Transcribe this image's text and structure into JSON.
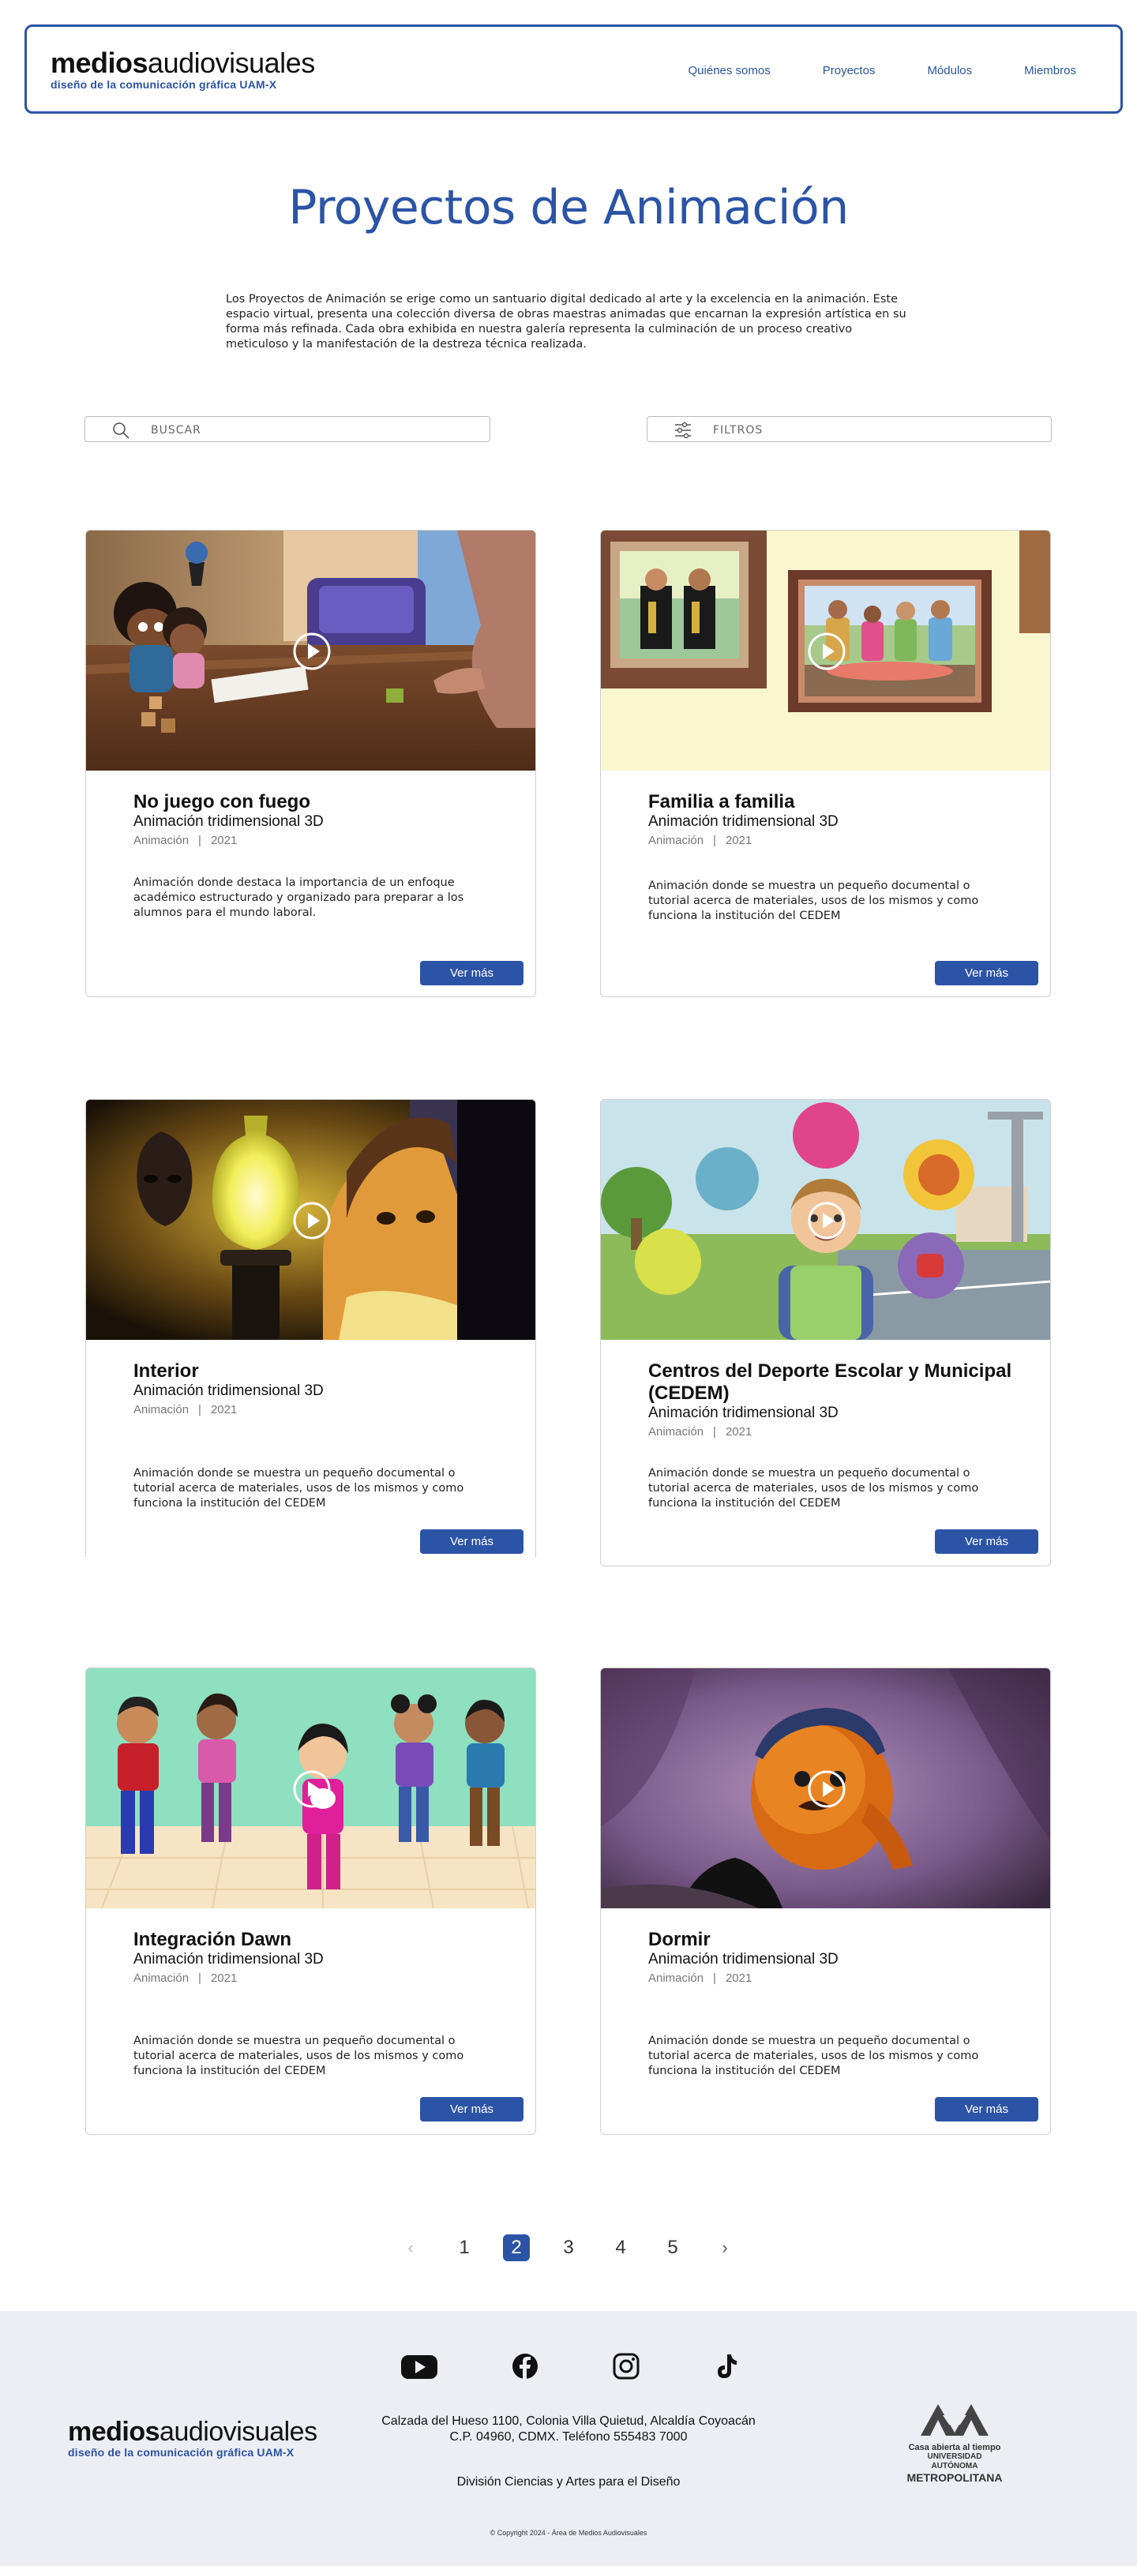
{
  "header": {
    "logo_bold": "medios",
    "logo_light": "audiovisuales",
    "logo_sub": "diseño de la comunicación gráfica  UAM-X",
    "nav": [
      "Quiénes somos",
      "Proyectos",
      "Módulos",
      "Miembros"
    ]
  },
  "page": {
    "title": "Proyectos de Animación",
    "intro": "Los Proyectos de Animación se erige como un santuario digital dedicado al arte y la excelencia en la animación. Este espacio virtual, presenta una colección diversa de obras maestras animadas que encarnan la expresión artística en su forma más refinada. Cada obra exhibida en nuestra galería representa la culminación de un proceso creativo meticuloso y la manifestación de la destreza técnica realizada."
  },
  "search": {
    "label": "BUSCAR",
    "icon": "search-icon"
  },
  "filters": {
    "label": "FILTROS",
    "icon": "sliders-icon"
  },
  "cards": [
    {
      "title": "No juego con fuego",
      "subtitle": "Animación tridimensional 3D",
      "category": "Animación",
      "sep": "|",
      "year": "2021",
      "description": "Animación donde destaca la importancia de un enfoque académico estructurado y organizado para preparar a los alumnos para el mundo laboral.",
      "button": "Ver más"
    },
    {
      "title": "Familia a familia",
      "subtitle": "Animación tridimensional 3D",
      "category": "Animación",
      "sep": "|",
      "year": "2021",
      "description": "Animación donde se muestra un pequeño documental o tutorial acerca de materiales, usos de los mismos y como funciona la institución del CEDEM",
      "button": "Ver más"
    },
    {
      "title": "Interior",
      "subtitle": "Animación tridimensional 3D",
      "category": "Animación",
      "sep": "|",
      "year": "2021",
      "description": "Animación donde se muestra un pequeño documental o tutorial acerca de materiales, usos de los mismos y como funciona la institución del CEDEM",
      "button": "Ver más"
    },
    {
      "title": "Centros del Deporte Escolar y Municipal (CEDEM)",
      "subtitle": "Animación tridimensional 3D",
      "category": "Animación",
      "sep": "|",
      "year": "2021",
      "description": "Animación donde se muestra un pequeño documental o tutorial acerca de materiales, usos de los mismos y como funciona la institución del CEDEM",
      "button": "Ver más"
    },
    {
      "title": "Integración Dawn",
      "subtitle": "Animación tridimensional 3D",
      "category": "Animación",
      "sep": "|",
      "year": "2021",
      "description": "Animación donde se muestra un pequeño documental o tutorial acerca de materiales, usos de los mismos y como funciona la institución del CEDEM",
      "button": "Ver más"
    },
    {
      "title": "Dormir",
      "subtitle": "Animación tridimensional 3D",
      "category": "Animación",
      "sep": "|",
      "year": "2021",
      "description": "Animación donde se muestra un pequeño documental o tutorial acerca de materiales, usos de los mismos y como funciona la institución del CEDEM",
      "button": "Ver más"
    }
  ],
  "pagination": {
    "prev": "‹",
    "next": "›",
    "pages": [
      "1",
      "2",
      "3",
      "4",
      "5"
    ],
    "current": "2"
  },
  "footer": {
    "social_icons": [
      "youtube-icon",
      "facebook-icon",
      "instagram-icon",
      "tiktok-icon"
    ],
    "logo_bold": "medios",
    "logo_light": "audiovisuales",
    "logo_sub": "diseño de la comunicación gráfica  UAM-X",
    "address_line1": "Calzada del Hueso 1100, Colonia Villa Quietud, Alcaldía Coyoacán",
    "address_line2": "C.P. 04960, CDMX. Teléfono 555483 7000",
    "division": "División Ciencias y Artes para el Diseño",
    "copyright": "© Copyright 2024 - Área de Medios Audiovisuales",
    "uam_line1": "Casa abierta al tiempo",
    "uam_line2": "UNIVERSIDAD AUTÓNOMA",
    "uam_line3": "METROPOLITANA"
  },
  "colors": {
    "brand": "#2b54a6",
    "footer_bg": "#eceef4"
  }
}
